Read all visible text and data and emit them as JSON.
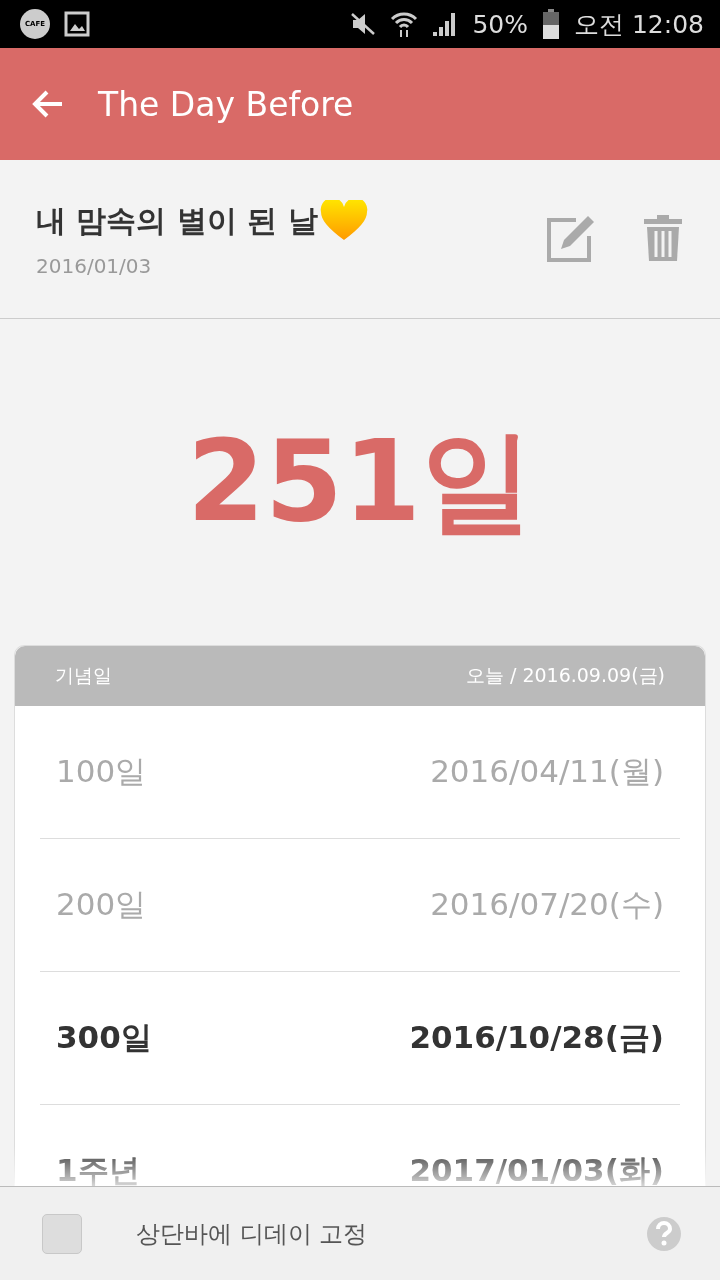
{
  "status_bar": {
    "cafe_badge": "CAFE",
    "battery": "50%",
    "time": "오전 12:08"
  },
  "app_bar": {
    "title": "The Day Before"
  },
  "event": {
    "title": "내 맘속의 별이 된 날",
    "date": "2016/01/03"
  },
  "count": "251일",
  "table": {
    "columns": [
      "기념일",
      "오늘 / 2016.09.09(금)"
    ],
    "rows": [
      {
        "label": "100일",
        "date": "2016/04/11(월)",
        "passed": true
      },
      {
        "label": "200일",
        "date": "2016/07/20(수)",
        "passed": true
      },
      {
        "label": "300일",
        "date": "2016/10/28(금)",
        "passed": false
      },
      {
        "label": "1주년",
        "date": "2017/01/03(화)",
        "passed": false
      }
    ]
  },
  "footer": {
    "checkbox": {
      "label": "상단바에 디데이 고정",
      "checked": false
    }
  }
}
